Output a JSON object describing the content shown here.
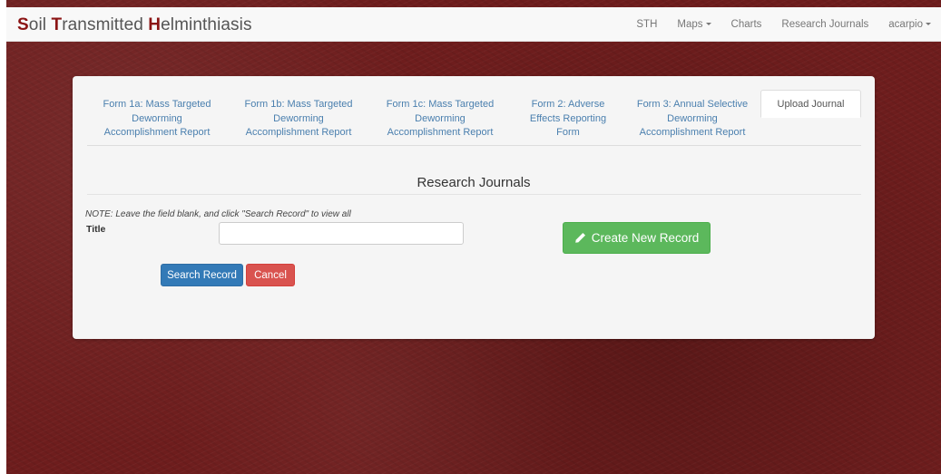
{
  "brand": {
    "s_cap": "S",
    "s_rest": "oil ",
    "t_cap": "T",
    "t_rest": "ransmitted ",
    "h_cap": "H",
    "h_rest": "elminthiasis"
  },
  "nav": {
    "sth": "STH",
    "maps": "Maps",
    "charts": "Charts",
    "journals": "Research Journals",
    "user": "acarpio"
  },
  "tabs": {
    "form1a": [
      "Form 1a: Mass Targeted",
      "Deworming",
      "Accomplishment Report"
    ],
    "form1b": [
      "Form 1b: Mass Targeted",
      "Deworming",
      "Accomplishment Report"
    ],
    "form1c": [
      "Form 1c: Mass Targeted",
      "Deworming",
      "Accomplishment Report"
    ],
    "form2": [
      "Form 2: Adverse",
      "Effects Reporting",
      "Form"
    ],
    "form3": [
      "Form 3: Annual Selective",
      "Deworming",
      "Accomplishment Report"
    ],
    "upload": "Upload Journal",
    "active": "upload"
  },
  "main": {
    "title": "Research Journals",
    "note": "NOTE: Leave the field blank, and click \"Search Record\" to view all",
    "title_label": "Title",
    "title_value": "",
    "create_label": "Create New Record",
    "search_label": "Search Record",
    "cancel_label": "Cancel"
  },
  "icons": {
    "pencil": "pencil-icon",
    "caret": "caret-down-icon"
  },
  "colors": {
    "background": "#6e1d1d",
    "brand_accent": "#8b1414",
    "link": "#4a7fae",
    "success": "#5cb85c",
    "primary": "#337ab7",
    "danger": "#d9534f"
  }
}
